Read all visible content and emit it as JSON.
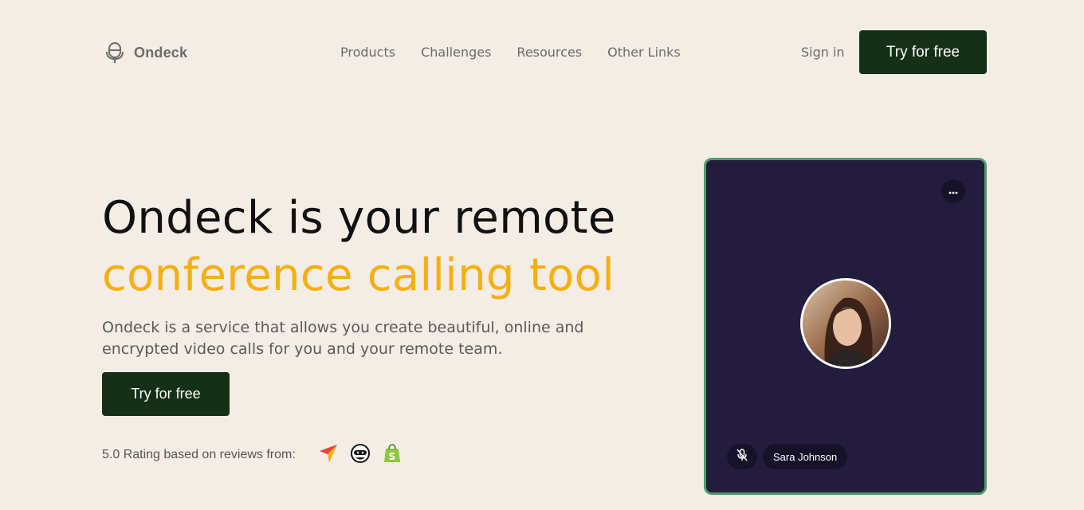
{
  "header": {
    "brand": "Ondeck",
    "nav": [
      {
        "label": "Products"
      },
      {
        "label": "Challenges"
      },
      {
        "label": "Resources"
      },
      {
        "label": "Other Links"
      }
    ],
    "signin_label": "Sign in",
    "cta_label": "Try for free"
  },
  "hero": {
    "title_line1": "Ondeck is your remote",
    "title_line2": "conference calling tool",
    "description": "Ondeck is a service that allows you create beautiful, online and encrypted video calls for you and your remote team.",
    "cta_label": "Try for free",
    "rating_text": "5.0 Rating based on reviews from:",
    "review_logos": [
      "paper-plane-logo-icon",
      "ninja-logo-icon",
      "shopify-bag-logo-icon"
    ]
  },
  "video_card": {
    "participant_name": "Sara Johnson",
    "more_icon": "ellipsis-icon",
    "mic_icon": "mic-muted-icon"
  },
  "colors": {
    "background": "#f4ede5",
    "primary_button": "#163017",
    "accent": "#f5b010",
    "card_bg": "#231c3d",
    "card_border": "#4f9d6e"
  }
}
